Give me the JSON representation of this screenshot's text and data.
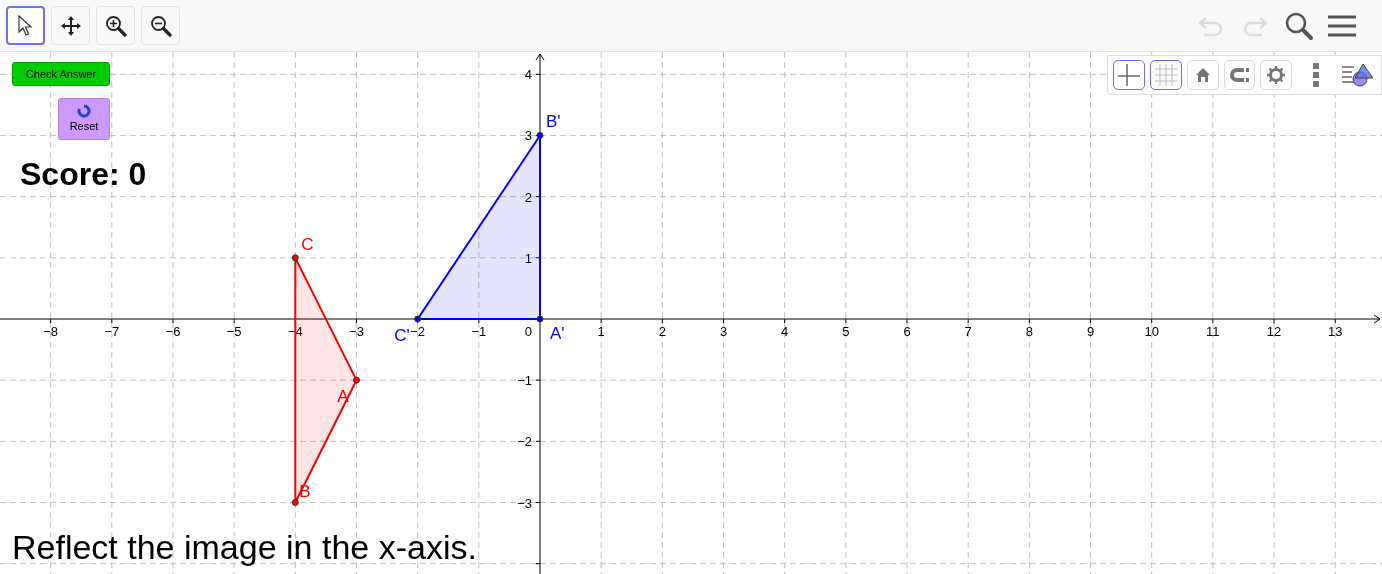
{
  "toolbar": {
    "tools": [
      {
        "kind": "move",
        "selected": true
      },
      {
        "kind": "pan",
        "selected": false
      },
      {
        "kind": "zoom_in",
        "selected": false
      },
      {
        "kind": "zoom_out",
        "selected": false
      }
    ],
    "actions": [
      {
        "kind": "undo",
        "disabled": true
      },
      {
        "kind": "redo",
        "disabled": true
      },
      {
        "kind": "search",
        "disabled": false
      },
      {
        "kind": "menu",
        "disabled": false
      }
    ]
  },
  "style_bar": [
    {
      "kind": "axes",
      "selected": true
    },
    {
      "kind": "grid",
      "selected": true
    },
    {
      "kind": "home",
      "selected": false
    },
    {
      "kind": "magnet",
      "selected": false
    },
    {
      "kind": "settings",
      "selected": false
    },
    {
      "kind": "more",
      "selected": false
    },
    {
      "kind": "views",
      "selected": false
    }
  ],
  "buttons": [
    {
      "kind": "check",
      "label": "Check Answer"
    },
    {
      "kind": "reset",
      "label": "Reset"
    }
  ],
  "score": "Score: 0",
  "instruction": "Reflect the image in the x-axis.",
  "graph": {
    "x_ticks": [
      "−8",
      "−7",
      "−6",
      "−5",
      "−4",
      "−3",
      "−2",
      "−1",
      "1",
      "2",
      "3",
      "4",
      "5",
      "6",
      "7",
      "8",
      "9",
      "10",
      "11",
      "12",
      "13"
    ],
    "y_ticks": [
      "4",
      "3",
      "2",
      "1",
      "−1",
      "−2",
      "−3"
    ],
    "origin_label": "0",
    "polygons": [
      {
        "color": "#ff0000",
        "points": [
          {
            "label": "C"
          },
          {
            "label": "A"
          },
          {
            "label": "B"
          }
        ]
      },
      {
        "color": "#0000ff",
        "points": [
          {
            "label": "A'"
          },
          {
            "label": "B'"
          },
          {
            "label": "C'"
          }
        ]
      }
    ]
  }
}
